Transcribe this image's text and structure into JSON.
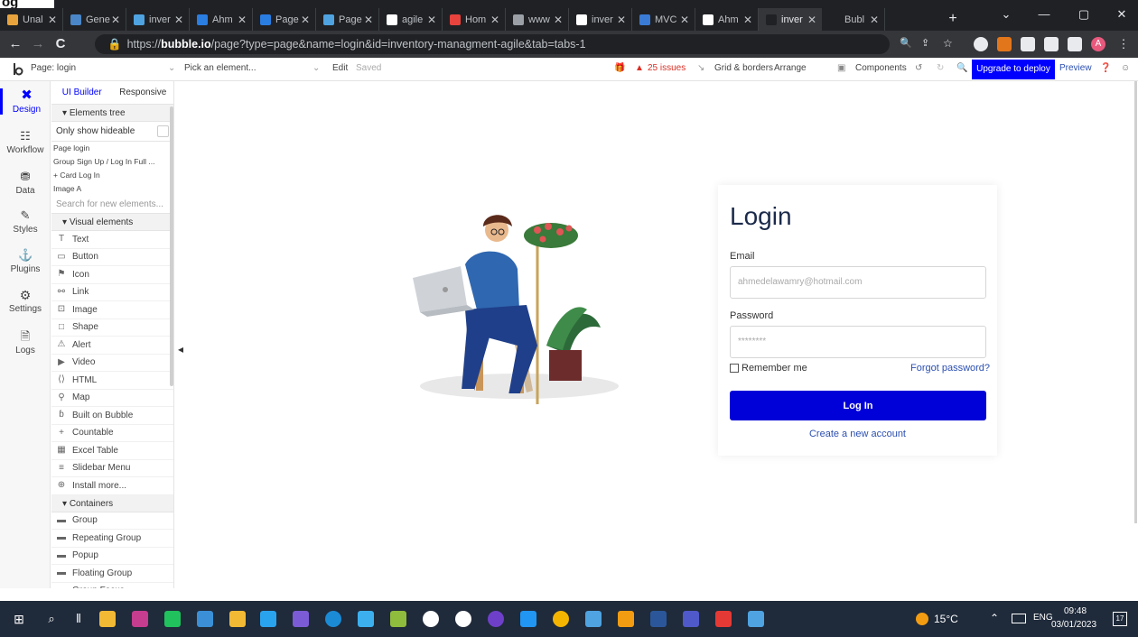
{
  "fragment": "og",
  "tabs": [
    {
      "label": "Unal",
      "color": "#e8a33d"
    },
    {
      "label": "Gene",
      "color": "#4a86c8"
    },
    {
      "label": "inver",
      "color": "#4fa3e0"
    },
    {
      "label": "Ahm",
      "color": "#2a7de1"
    },
    {
      "label": "Page",
      "color": "#2a7de1"
    },
    {
      "label": "Page",
      "color": "#4fa3e0"
    },
    {
      "label": "agile",
      "color": "#ffffff"
    },
    {
      "label": "Hom",
      "color": "#e8433d"
    },
    {
      "label": "www",
      "color": "#9aa0a6"
    },
    {
      "label": "inver",
      "color": "#ffffff"
    },
    {
      "label": "MVC",
      "color": "#3a7bd5"
    },
    {
      "label": "Ahm",
      "color": "#ffffff"
    },
    {
      "label": "inver",
      "color": "#202124"
    },
    {
      "label": "Bubl",
      "color": "#202124"
    }
  ],
  "tab_close": "✕",
  "new_tab": "+",
  "window_controls": [
    "⌄",
    "—",
    "▢",
    "✕"
  ],
  "nav": {
    "back": "←",
    "forward": "→",
    "reload": "C"
  },
  "url": {
    "prefix": "https://",
    "domain": "bubble.io",
    "path": "/page?type=page&name=login&id=inventory-managment-agile&tab=tabs-1"
  },
  "toolbar": {
    "page": "Page: login",
    "pick": "Pick an element...",
    "edit": "Edit",
    "saved": "Saved",
    "issues": "25 issues",
    "grid": "Grid & borders",
    "arrange": "Arrange",
    "components": "Components",
    "upgrade": "Upgrade to deploy",
    "preview": "Preview"
  },
  "rail": [
    {
      "label": "Design",
      "active": true
    },
    {
      "label": "Workflow"
    },
    {
      "label": "Data"
    },
    {
      "label": "Styles"
    },
    {
      "label": "Plugins"
    },
    {
      "label": "Settings"
    },
    {
      "label": "Logs"
    }
  ],
  "palette": {
    "tab_builder": "UI Builder",
    "tab_responsive": "Responsive",
    "elements_tree": "Elements tree",
    "only_hideable": "Only show hideable",
    "tree": [
      "Page login",
      "Group Sign Up / Log In Full ...",
      "+ Card Log In",
      "Image A"
    ],
    "search": "Search for new elements...",
    "visual_header": "Visual elements",
    "visual": [
      "Text",
      "Button",
      "Icon",
      "Link",
      "Image",
      "Shape",
      "Alert",
      "Video",
      "HTML",
      "Map",
      "Built on Bubble",
      "Countable",
      "Excel Table",
      "Slidebar Menu",
      "Install more..."
    ],
    "containers_header": "Containers",
    "containers": [
      "Group",
      "Repeating Group",
      "Popup",
      "Floating Group",
      "Group Focus"
    ]
  },
  "login": {
    "title": "Login",
    "email_label": "Email",
    "email_placeholder": "ahmedelawamry@hotmail.com",
    "password_label": "Password",
    "password_placeholder": "********",
    "remember": "Remember me",
    "forgot": "Forgot password?",
    "button": "Log In",
    "create": "Create a new account"
  },
  "tray": {
    "temp": "15°C",
    "lang": "ENG",
    "time": "09:48",
    "date": "03/01/2023",
    "notif": "17"
  },
  "colors": {
    "accent": "#0000ff",
    "login_button": "#0000d8",
    "link": "#2b4fb0",
    "issues": "#d93025"
  }
}
